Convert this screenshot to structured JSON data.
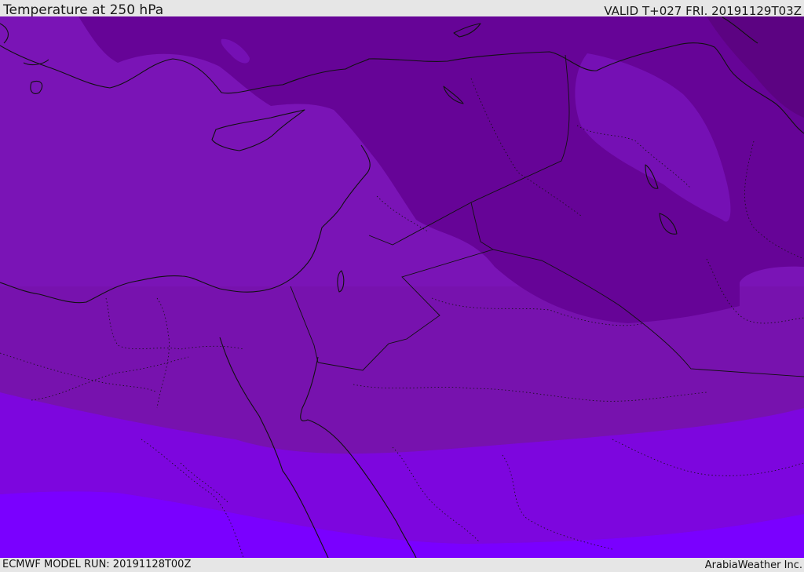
{
  "header": {
    "title": "Temperature at 250 hPa",
    "valid": "VALID T+027 FRI. 20191129T03Z"
  },
  "footer": {
    "model_run": "ECMWF MODEL RUN: 20191128T00Z",
    "credit": "ArabiaWeather Inc."
  },
  "colors": {
    "band_darkest": "#5c0382",
    "band_dark": "#660497",
    "band_mid": "#7510b4",
    "band_mid2": "#7712b0",
    "band_light": "#7d06de",
    "band_lightest": "#7a00ff",
    "coastline": "#111111"
  }
}
